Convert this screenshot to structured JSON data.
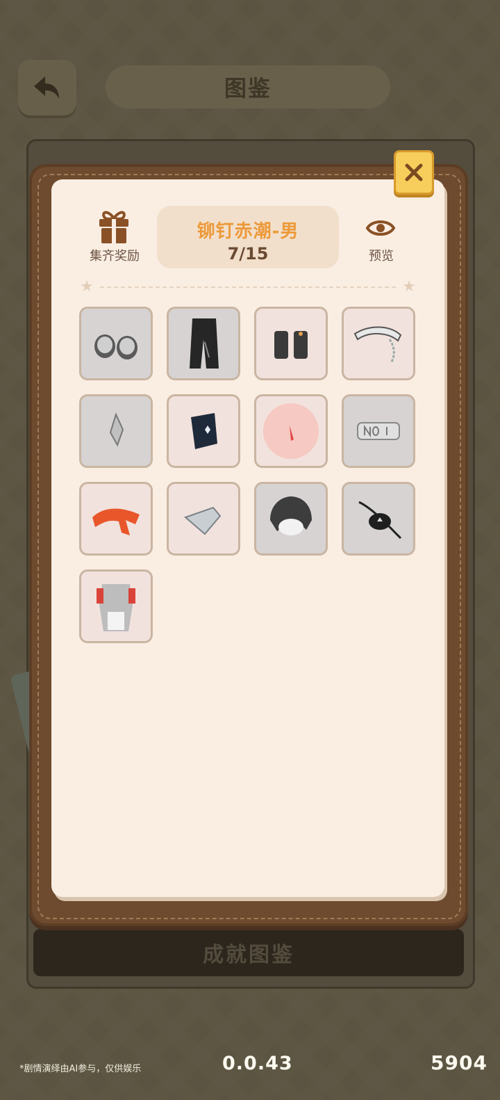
{
  "background_screen": {
    "title": "图鉴",
    "bottom_button": "成就图鉴"
  },
  "modal": {
    "reward_label": "集齐奖励",
    "set_name": "铆钉赤潮-男",
    "set_progress": "7/15",
    "preview_label": "预览",
    "items": [
      {
        "icon": "shoes-icon",
        "state": "collected"
      },
      {
        "icon": "pants-icon",
        "state": "collected"
      },
      {
        "icon": "gloves-icon",
        "state": "uncollected"
      },
      {
        "icon": "belt-chain-icon",
        "state": "uncollected"
      },
      {
        "icon": "earring-icon",
        "state": "collected"
      },
      {
        "icon": "wristband-icon",
        "state": "uncollected"
      },
      {
        "icon": "nail-icon",
        "state": "uncollected"
      },
      {
        "icon": "no1-sticker-icon",
        "state": "collected"
      },
      {
        "icon": "scarf-icon",
        "state": "uncollected"
      },
      {
        "icon": "bandana-icon",
        "state": "uncollected"
      },
      {
        "icon": "hair-icon",
        "state": "collected"
      },
      {
        "icon": "eyepatch-icon",
        "state": "collected"
      },
      {
        "icon": "outfit-icon",
        "state": "uncollected"
      }
    ]
  },
  "footer": {
    "note": "*剧情演绎由AI参与，仅供娱乐",
    "version": "0.0.43",
    "number": "5904"
  },
  "colors": {
    "paper": "#faeee3",
    "frame": "#6e4a2e",
    "accent": "#ec9a3a",
    "close_button": "#f7cd5c"
  }
}
